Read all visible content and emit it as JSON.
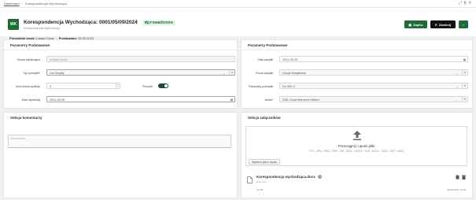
{
  "breadcrumb": {
    "root": "Dashboard",
    "separator": "/",
    "current": "Korespondencja Wychodząca"
  },
  "header": {
    "logo_text": "WK",
    "title": "Korespondencja Wychodząca: 0001/05/09/2024",
    "status": "Wprowadzono",
    "subtitle": "Korespondencja Wychodząca",
    "meta_creator_label": "Pierwotnie kreat:",
    "meta_creator_value": "Łukasz Szulc",
    "meta_created_label": "Przekazano:",
    "meta_created_value": "05.09.2024"
  },
  "actions": {
    "save_label": "Zapisz",
    "close_label": "Zamknij"
  },
  "basic_left": {
    "title": "Parametry Podstawowe",
    "registrant_label": "Osoba rejestrująca",
    "registrant_value": "Łukasz Szulc",
    "type_label": "Typ przesyłki*",
    "type_value": "List Zwykły",
    "sheets_label": "Ilość liczba wydłuży",
    "sheets_value": "0",
    "priority_label": "Priorytet",
    "reg_date_label": "Data rejestracji",
    "reg_date_value": "2024-09-05"
  },
  "basic_right": {
    "title": "Parametry Podstawowe",
    "send_date_label": "Data wysyłki",
    "send_date_value": "2024-09-05",
    "form_label": "Forma wysyłki",
    "form_value": "Urząd Wysyłkowy",
    "weight_label": "Parametry przesyłki",
    "weight_value": "Do 500 G",
    "sender_label": "Jedna*",
    "sender_value": "DWL Dział Wdrożeń Hikium"
  },
  "comments": {
    "title": "Sekcja komentarzy",
    "placeholder": "Komentarz..."
  },
  "attachments": {
    "title": "Sekcja załączników",
    "drop_title": "Przeciągnij i upuść pliki",
    "drop_types": "TXT, .JPG, .PNG, .PDF, .ZIP, .DOC, .DOCX, .XLS, .XLSX, .ODS, .ODT, .MSG",
    "pick_label": "Wybierz pliki z dysku",
    "file_name": "Korespondencja wychodząca.docx",
    "file_sub": "Brak opis",
    "file_size": "14 KB",
    "file_date": "05.09.2024, 11:29"
  },
  "colors": {
    "brand": "#1f6b3a",
    "status_bg": "#e7f6ec",
    "status_fg": "#1f7a42"
  },
  "toggles": {
    "priority": true
  },
  "icons": [
    "upload-icon",
    "calendar-icon",
    "chevron-down-icon",
    "clear-icon",
    "file-icon",
    "download-icon",
    "trash-icon",
    "info-icon",
    "save-icon",
    "close-icon"
  ]
}
